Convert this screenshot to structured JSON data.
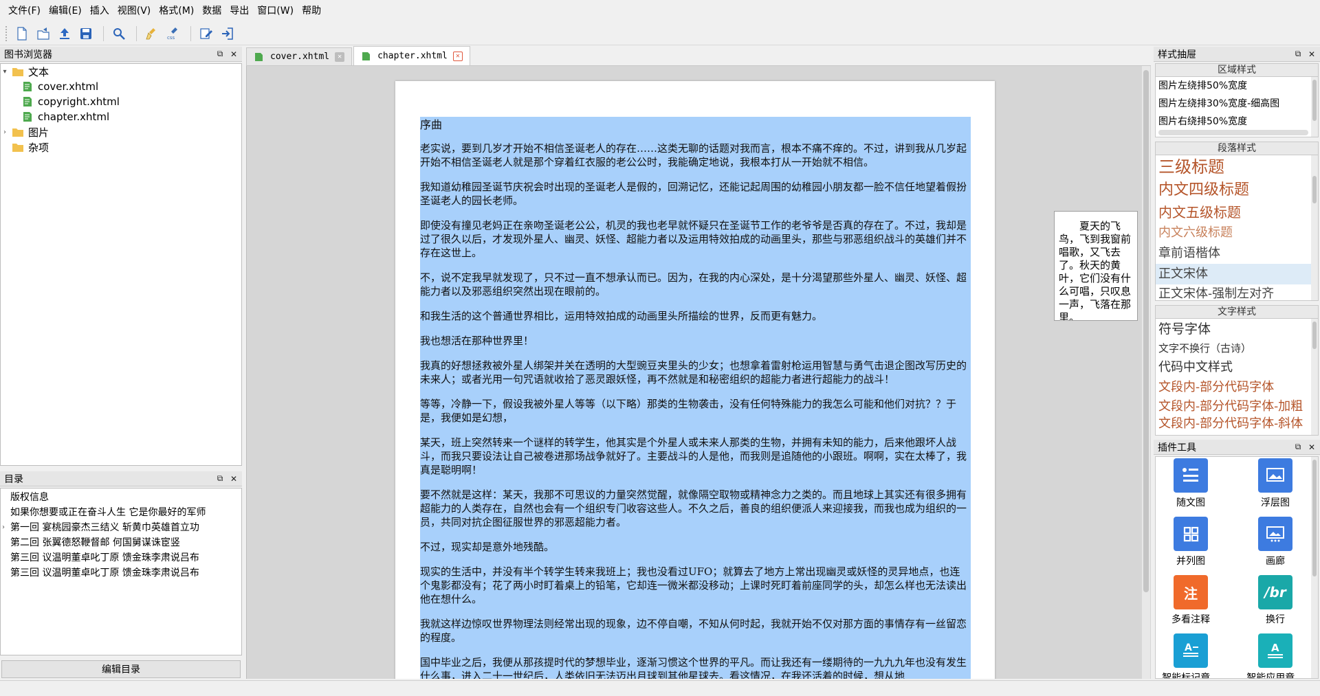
{
  "menubar": {
    "items": [
      "文件(F)",
      "编辑(E)",
      "插入",
      "视图(V)",
      "格式(M)",
      "数据",
      "导出",
      "窗口(W)",
      "帮助"
    ]
  },
  "toolbar": {
    "buttons": [
      "new-file-icon",
      "open-file-icon",
      "upload-icon",
      "save-icon",
      "search-icon",
      "clean-icon",
      "css-icon",
      "edit-icon",
      "import-icon"
    ]
  },
  "book_browser": {
    "title": "图书浏览器",
    "items": [
      {
        "label": "文本",
        "type": "folder",
        "expanded": true
      },
      {
        "label": "cover.xhtml",
        "type": "file"
      },
      {
        "label": "copyright.xhtml",
        "type": "file"
      },
      {
        "label": "chapter.xhtml",
        "type": "file"
      },
      {
        "label": "图片",
        "type": "folder",
        "expanded": false
      },
      {
        "label": "杂项",
        "type": "folder",
        "expanded": false
      }
    ]
  },
  "toc": {
    "title": "目录",
    "items": [
      "版权信息",
      "如果你想要或正在奋斗人生 它是你最好的军师",
      "第一回 宴桃园豪杰三结义 斩黄巾英雄首立功",
      "第二回 张翼德怒鞭督邮 何国舅谋诛宦竖",
      "第三回 议温明董卓叱丁原 馈金珠李肃说吕布",
      "第三回 议温明董卓叱丁原 馈金珠李肃说吕布"
    ],
    "edit_button": "编辑目录"
  },
  "tabs": [
    {
      "label": "cover.xhtml",
      "active": false
    },
    {
      "label": "chapter.xhtml",
      "active": true
    }
  ],
  "document": {
    "chapter_title": "序曲",
    "paragraphs": [
      "老实说，要到几岁才开始不相信圣诞老人的存在……这类无聊的话题对我而言，根本不痛不痒的。不过，讲到我从几岁起开始不相信圣诞老人就是那个穿着红衣服的老公公时，我能确定地说，我根本打从一开始就不相信。",
      "我知道幼稚园圣诞节庆祝会时出现的圣诞老人是假的，回溯记忆，还能记起周围的幼稚园小朋友都一脸不信任地望着假扮圣诞老人的园长老师。",
      "即使没有撞见老妈正在亲吻圣诞老公公，机灵的我也老早就怀疑只在圣诞节工作的老爷爷是否真的存在了。不过，我却是过了很久以后，才发现外星人、幽灵、妖怪、超能力者以及运用特效拍成的动画里头，那些与邪恶组织战斗的英雄们并不存在这世上。",
      "不，说不定我早就发现了，只不过一直不想承认而已。因为，在我的内心深处，是十分渴望那些外星人、幽灵、妖怪、超能力者以及邪恶组织突然出现在眼前的。",
      "和我生活的这个普通世界相比，运用特效拍成的动画里头所描绘的世界，反而更有魅力。",
      "我也想活在那种世界里！",
      "我真的好想拯救被外星人绑架并关在透明的大型豌豆夹里头的少女；也想拿着雷射枪运用智慧与勇气击退企图改写历史的未来人；或者光用一句咒语就收拾了恶灵跟妖怪，再不然就是和秘密组织的超能力者进行超能力的战斗！",
      "等等，冷静一下，假设我被外星人等等（以下略）那类的生物袭击，没有任何特殊能力的我怎么可能和他们对抗？？于是，我便如是幻想，",
      "某天，班上突然转来一个谜样的转学生，他其实是个外星人或未来人那类的生物，并拥有未知的能力，后来他跟坏人战斗，而我只要设法让自己被卷进那场战争就好了。主要战斗的人是他，而我则是追随他的小跟班。啊啊，实在太棒了，我真是聪明啊！",
      "要不然就是这样：某天，我那不可思议的力量突然觉醒，就像隔空取物或精神念力之类的。而且地球上其实还有很多拥有超能力的人类存在，自然也会有一个组织专门收容这些人。不久之后，善良的组织便派人来迎接我，而我也成为组织的一员，共同对抗企图征服世界的邪恶超能力者。",
      "不过，现实却是意外地残酷。",
      "现实的生活中，并没有半个转学生转来我班上；我也没看过UFO；就算去了地方上常出现幽灵或妖怪的灵异地点，也连个鬼影都没有；花了两小时盯着桌上的铅笔，它却连一微米都没移动；上课时死盯着前座同学的头，却怎么样也无法读出他在想什么。",
      "我就这样边惊叹世界物理法则经常出现的现象，边不停自嘲，不知从何时起，我就开始不仅对那方面的事情存有一丝留恋的程度。",
      "国中毕业之后，我便从那孩提时代的梦想毕业，逐渐习惯这个世界的平凡。而让我还有一缕期待的一九九九年也没有发生什么事，进入二十一世纪后，人类依旧无法迈出月球到其他星球去。看这情况，在我还活着的时候，想从地"
    ]
  },
  "float_note": {
    "text": "夏天的飞鸟，飞到我窗前唱歌，又飞去了。秋天的黄叶，它们没有什么可唱，只叹息一声，飞落在那里。"
  },
  "style_drawer": {
    "title": "样式抽屉",
    "area_styles_title": "区域样式",
    "area_styles": [
      "图片左绕排50%宽度",
      "图片左绕排30%宽度-细高图",
      "图片右绕排50%宽度"
    ],
    "para_styles_title": "段落样式",
    "para_styles": [
      "三级标题",
      "内文四级标题",
      "内文五级标题",
      "内文六级标题",
      "章前语楷体",
      "正文宋体",
      "正文宋体-强制左对齐"
    ],
    "text_styles_title": "文字样式",
    "text_styles": [
      "符号字体",
      "文字不换行（古诗）",
      "代码中文样式",
      "文段内-部分代码字体",
      "文段内-部分代码字体-加粗",
      "文段内-部分代码字体-斜体"
    ]
  },
  "plugins": {
    "title": "插件工具",
    "items": [
      {
        "label": "随文图",
        "color": "#3d7be0",
        "icon": "list-image-icon"
      },
      {
        "label": "浮层图",
        "color": "#3d7be0",
        "icon": "float-image-icon"
      },
      {
        "label": "并列图",
        "color": "#3d7be0",
        "icon": "grid-image-icon"
      },
      {
        "label": "画廊",
        "color": "#3d7be0",
        "icon": "gallery-icon"
      },
      {
        "label": "多看注释",
        "color": "#f06a2b",
        "icon": "annotation-icon"
      },
      {
        "label": "换行",
        "color": "#1aa8a8",
        "icon": "line-break-icon"
      },
      {
        "label": "智能标记章...",
        "color": "#1a9fd4",
        "icon": "smart-mark-icon"
      },
      {
        "label": "智能应用章...",
        "color": "#1ab0b8",
        "icon": "smart-apply-icon"
      }
    ],
    "annotation_glyph": "注",
    "linebreak_glyph": "/br"
  },
  "colors": {
    "selection": "#a8d0fb",
    "para_style_text": "#b5552a",
    "text_style_accent": "#b5552a"
  }
}
